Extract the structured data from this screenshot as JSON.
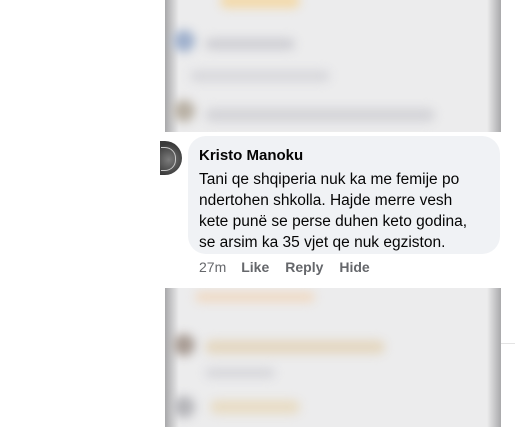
{
  "comment": {
    "author": "Kristo Manoku",
    "text_lines": [
      "Tani qe shqiperia nuk ka me femije po",
      "ndertohen shkolla. Hajde merre vesh",
      "kete punë se perse duhen keto godina,",
      "se arsim ka 35 vjet qe nuk egziston."
    ],
    "timestamp": "27m",
    "actions": {
      "like": "Like",
      "reply": "Reply",
      "hide": "Hide"
    }
  },
  "colors": {
    "bubble_bg": "#f0f2f5",
    "text": "#050505",
    "meta_text": "#65676b",
    "blurred_bg": "#ececed"
  }
}
